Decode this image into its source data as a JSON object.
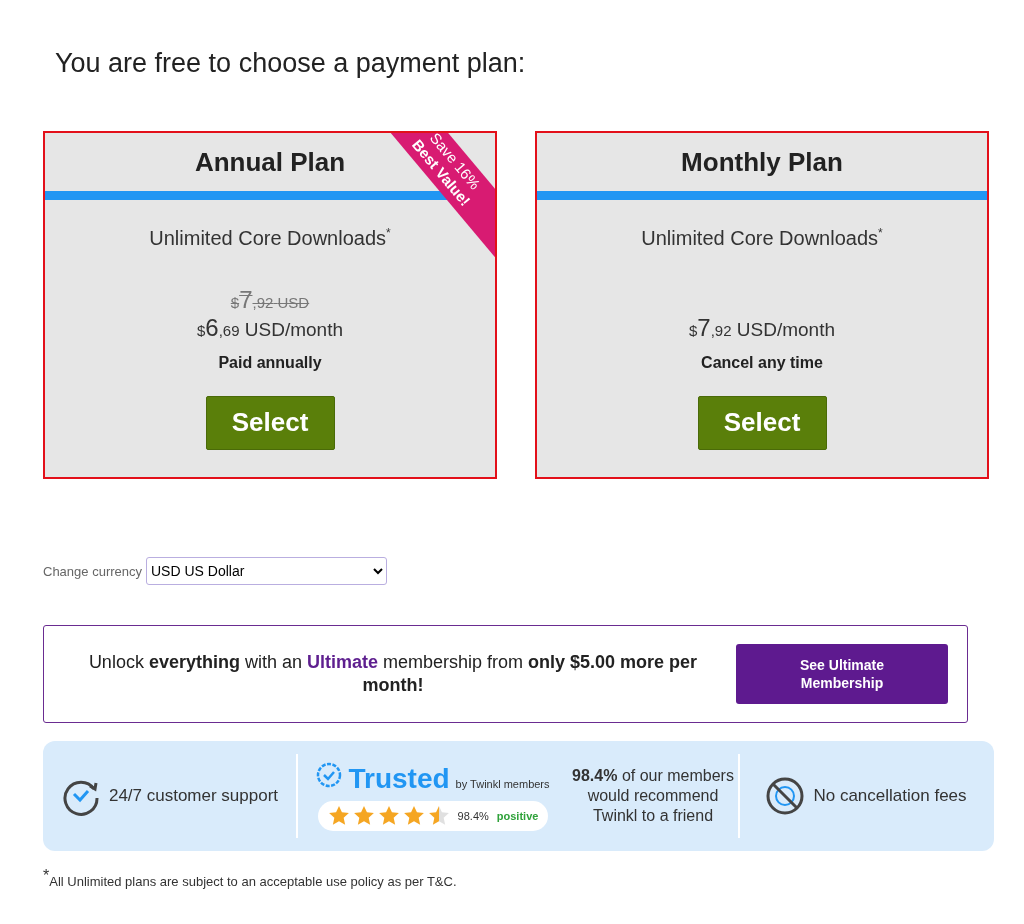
{
  "heading": "You are free to choose a payment plan:",
  "plans": [
    {
      "title": "Annual Plan",
      "feature": "Unlimited Core Downloads$^{*}$",
      "ribbon": {
        "line1": "Save 16%",
        "line2": "Best Value!"
      },
      "old_price": {
        "currency": "$",
        "whole": "7",
        "cents": ",92",
        "unit": "USD"
      },
      "price": {
        "currency": "$",
        "whole": "6",
        "cents": ",69",
        "unit": "USD/month"
      },
      "note": "Paid annually",
      "button": "Select"
    },
    {
      "title": "Monthly Plan",
      "feature": "Unlimited Core Downloads$^{*}$",
      "price": {
        "currency": "$",
        "whole": "7",
        "cents": ",92",
        "unit": "USD/month"
      },
      "note": "Cancel any time",
      "button": "Select"
    }
  ],
  "currency": {
    "label": "Change currency",
    "value": "USD US Dollar"
  },
  "upsell": {
    "text": "Unlock **everything** with an *Ultimate* membership from **only $5.00 more per month!**",
    "button": "See Ultimate Membership"
  },
  "trust": {
    "support": "24/7 customer support",
    "trusted": "Trusted",
    "by": "by Twinkl members",
    "stars": 4.5,
    "percent": "98.4%",
    "positive": "positive",
    "recommend": "**98.4%** of our members would recommend Twinkl to a friend",
    "no_fees": "No cancellation fees"
  },
  "footnote": "$^{*}$All Unlimited plans are subject to an acceptable use policy as per T&C."
}
